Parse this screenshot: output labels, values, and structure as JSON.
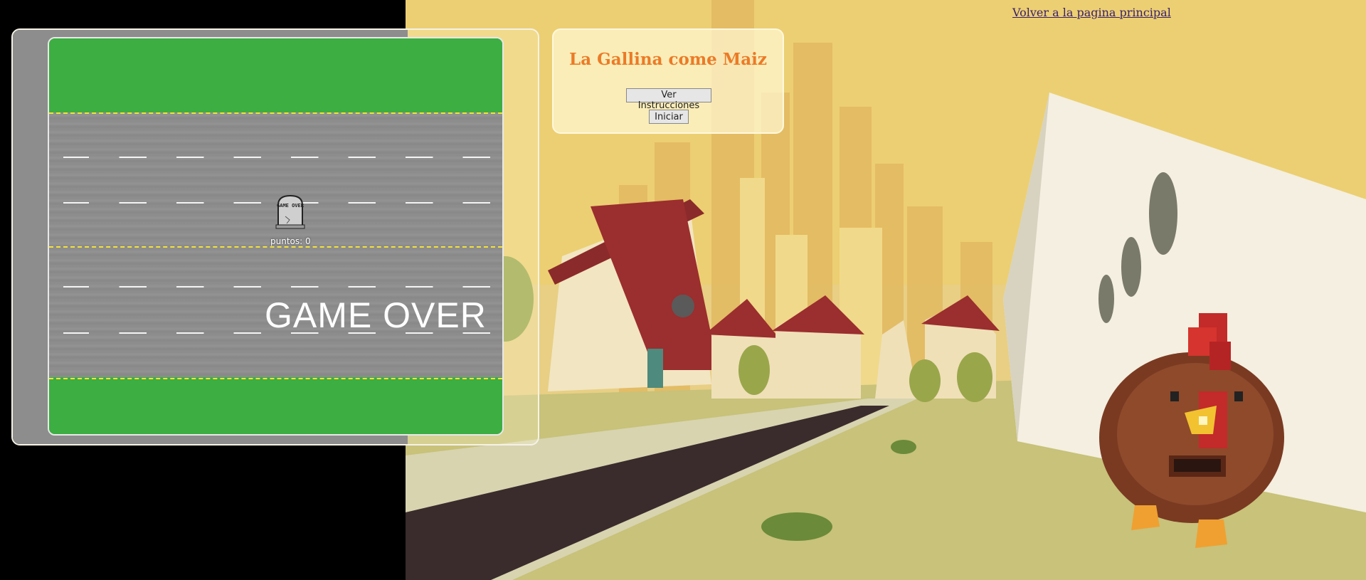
{
  "nav": {
    "home_link": "Volver a la pagina principal"
  },
  "menu": {
    "title": "La Gallina come Maiz",
    "instructions_button": "Ver Instrucciones",
    "start_button": "Iniciar"
  },
  "game": {
    "score_label": "puntos: 0",
    "gameover_text": "GAME OVER",
    "tombstone_text": "GAME OVER"
  },
  "colors": {
    "grass": "#3cae42",
    "road": "#8a8a8a",
    "lane_divider": "#f4e23a",
    "title": "#ec7a26"
  }
}
